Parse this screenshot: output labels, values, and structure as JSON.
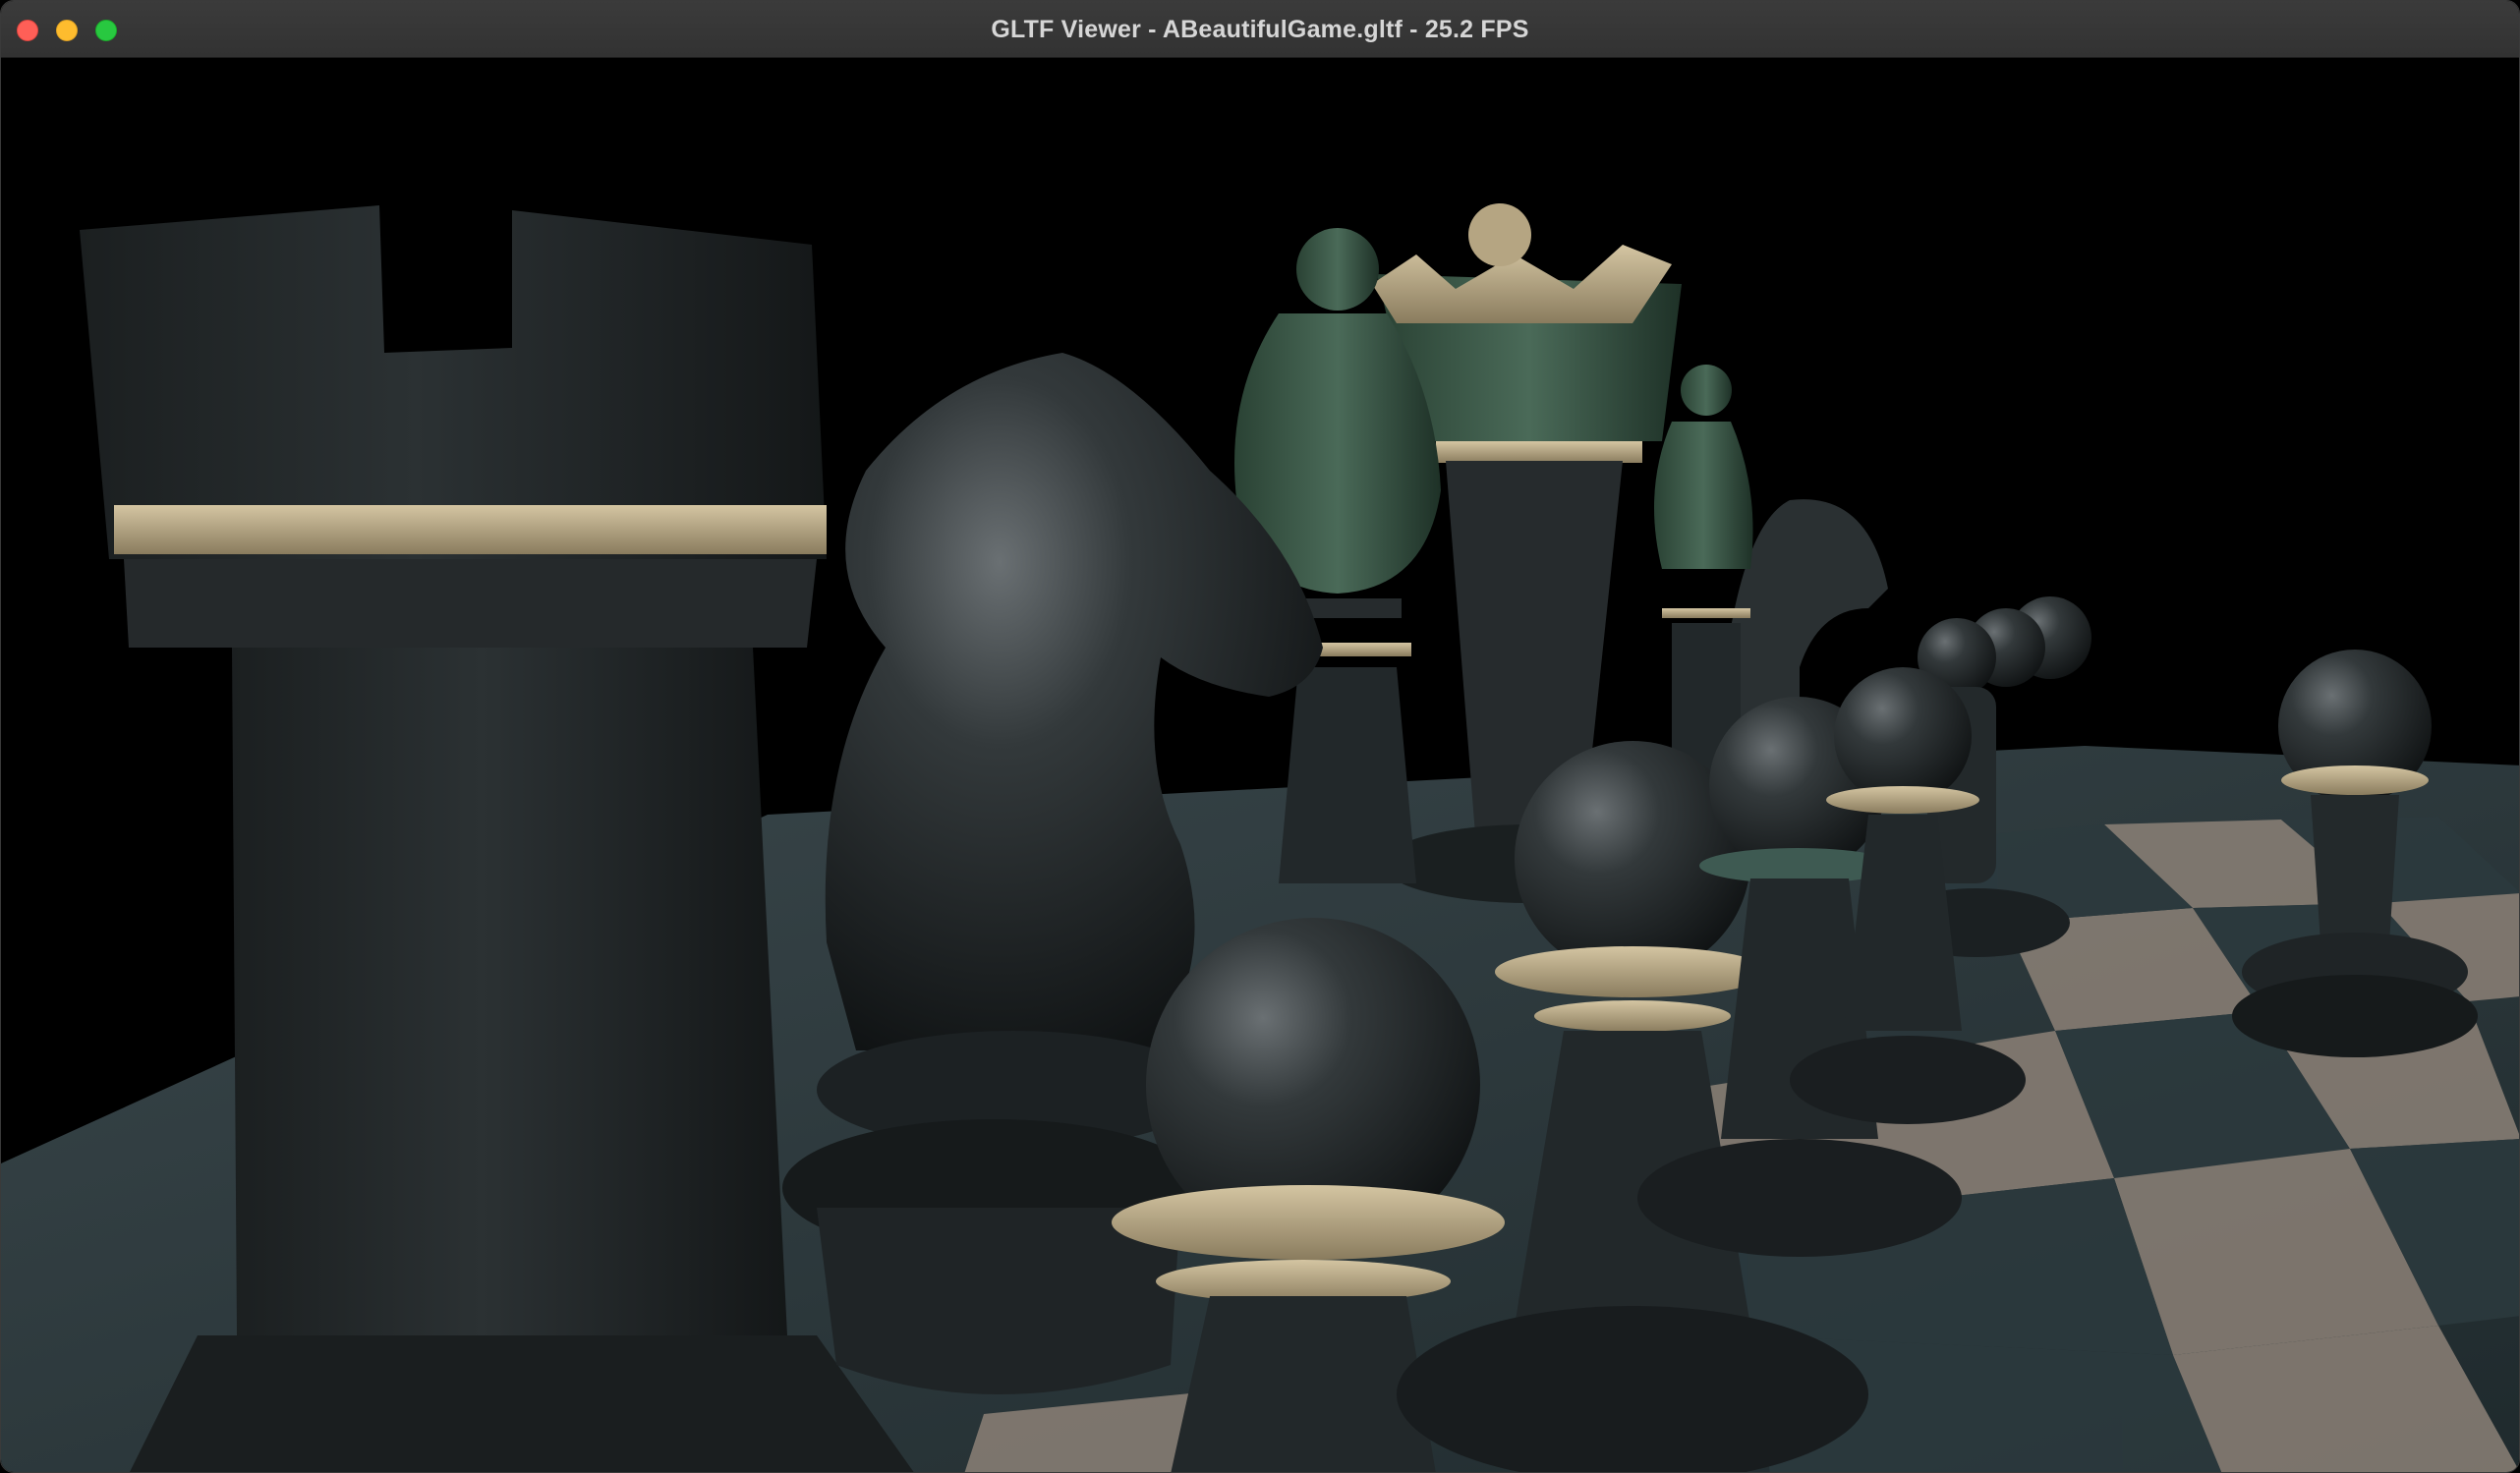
{
  "window": {
    "title": "GLTF Viewer - ABeautifulGame.gltf - 25.2 FPS",
    "controls": {
      "close": "close-button",
      "minimize": "minimize-button",
      "maximize": "maximize-button"
    }
  },
  "scene": {
    "background_color": "#000000",
    "board_light_color": "#8c8177",
    "board_dark_color": "#2c3a3e",
    "piece_black_color": "#262b2d",
    "piece_green_color": "#35503f",
    "accent_gold_color": "#b5a582"
  }
}
